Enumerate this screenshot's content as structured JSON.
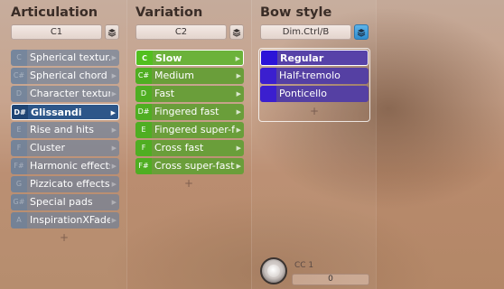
{
  "articulation": {
    "title": "Articulation",
    "selector_value": "C1",
    "layers_icon": "layers-icon",
    "items": [
      {
        "key": "C",
        "label": "Spherical textur."
      },
      {
        "key": "C#",
        "label": "Spherical chord t."
      },
      {
        "key": "D",
        "label": "Character textur."
      },
      {
        "key": "D#",
        "label": "Glissandi"
      },
      {
        "key": "E",
        "label": "Rise and hits"
      },
      {
        "key": "F",
        "label": "Cluster"
      },
      {
        "key": "F#",
        "label": "Harmonic effects"
      },
      {
        "key": "G",
        "label": "Pizzicato effects"
      },
      {
        "key": "G#",
        "label": "Special pads"
      },
      {
        "key": "A",
        "label": "InspirationXFades"
      }
    ],
    "selected_index": 3,
    "add_label": "+"
  },
  "variation": {
    "title": "Variation",
    "selector_value": "C2",
    "layers_icon": "layers-icon",
    "items": [
      {
        "key": "C",
        "label": "Slow"
      },
      {
        "key": "C#",
        "label": "Medium"
      },
      {
        "key": "D",
        "label": "Fast"
      },
      {
        "key": "D#",
        "label": "Fingered fast"
      },
      {
        "key": "E",
        "label": "Fingered super-f."
      },
      {
        "key": "F",
        "label": "Cross fast"
      },
      {
        "key": "F#",
        "label": "Cross super-fast"
      }
    ],
    "selected_index": 0,
    "add_label": "+"
  },
  "bow_style": {
    "title": "Bow style",
    "selector_value": "Dim.Ctrl/B",
    "layers_icon": "layers-icon",
    "items": [
      {
        "key": "",
        "label": "Regular"
      },
      {
        "key": "",
        "label": "Half-tremolo"
      },
      {
        "key": "",
        "label": "Ponticello"
      }
    ],
    "selected_index": 0,
    "add_label": "+"
  },
  "cc": {
    "label": "CC 1",
    "value": "0"
  },
  "colors": {
    "articulation_item": "#66809e",
    "articulation_selected": "#2d5689",
    "variation_item": "#6a9e3a",
    "variation_key": "#4fae22",
    "bow_item": "#5540a3",
    "bow_key": "#3b1fcf",
    "bow_layers_button": "#3d9ee0"
  }
}
